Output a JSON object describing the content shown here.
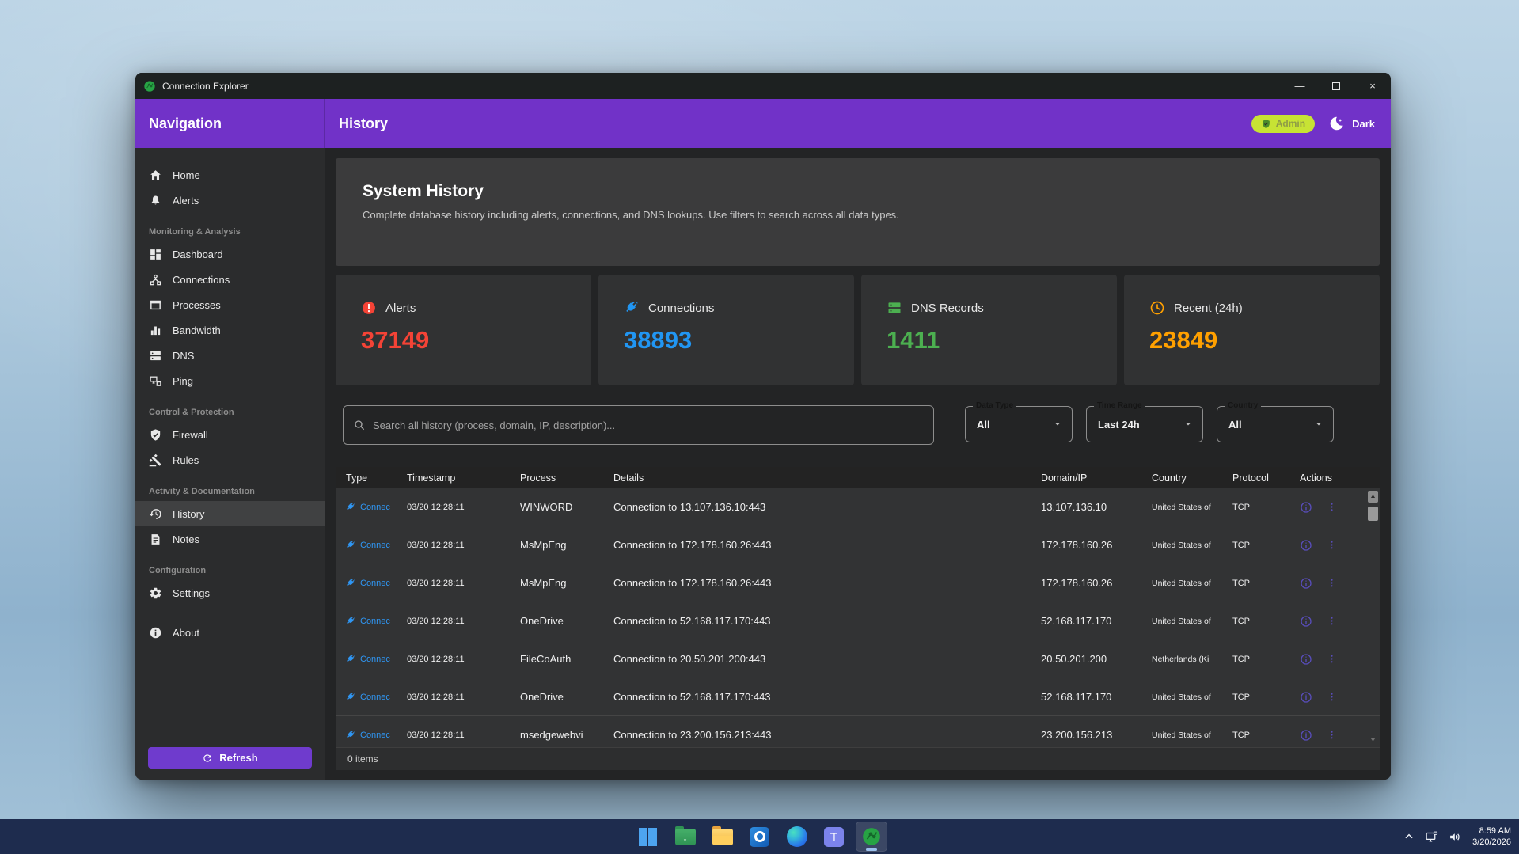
{
  "window": {
    "titlebar": {
      "title": "Connection Explorer"
    },
    "header": {
      "nav_title": "Navigation",
      "page_title": "History",
      "admin_badge": "Admin",
      "theme_label": "Dark"
    },
    "sidebar": {
      "items": [
        {
          "label": "Home"
        },
        {
          "label": "Alerts"
        },
        {
          "section": "Monitoring & Analysis"
        },
        {
          "label": "Dashboard"
        },
        {
          "label": "Connections"
        },
        {
          "label": "Processes"
        },
        {
          "label": "Bandwidth"
        },
        {
          "label": "DNS"
        },
        {
          "label": "Ping"
        },
        {
          "section": "Control & Protection"
        },
        {
          "label": "Firewall"
        },
        {
          "label": "Rules"
        },
        {
          "section": "Activity & Documentation"
        },
        {
          "label": "History"
        },
        {
          "label": "Notes"
        },
        {
          "section": "Configuration"
        },
        {
          "label": "Settings"
        },
        {
          "label": "About"
        }
      ],
      "refresh_label": "Refresh"
    },
    "main": {
      "hero": {
        "title": "System History",
        "subtitle": "Complete database history including alerts, connections, and DNS lookups. Use filters to search across all data types."
      },
      "stats": [
        {
          "label": "Alerts",
          "value": "37149",
          "color": "#f44336"
        },
        {
          "label": "Connections",
          "value": "38893",
          "color": "#2196f3"
        },
        {
          "label": "DNS Records",
          "value": "1411",
          "color": "#4caf50"
        },
        {
          "label": "Recent (24h)",
          "value": "23849",
          "color": "#ffa000"
        }
      ],
      "filters": {
        "search_placeholder": "Search all history (process, domain, IP, description)...",
        "dropdowns": [
          {
            "label": "Data Type",
            "value": "All"
          },
          {
            "label": "Time Range",
            "value": "Last 24h"
          },
          {
            "label": "Country",
            "value": "All"
          }
        ]
      },
      "table": {
        "columns": [
          "Type",
          "Timestamp",
          "Process",
          "Details",
          "Domain/IP",
          "Country",
          "Protocol",
          "Actions"
        ],
        "rows": [
          {
            "type": "Connec",
            "timestamp": "03/20 12:28:11",
            "process": "WINWORD",
            "details": "Connection to 13.107.136.10:443",
            "domain_ip": "13.107.136.10",
            "country": "United States of",
            "protocol": "TCP"
          },
          {
            "type": "Connec",
            "timestamp": "03/20 12:28:11",
            "process": "MsMpEng",
            "details": "Connection to 172.178.160.26:443",
            "domain_ip": "172.178.160.26",
            "country": "United States of",
            "protocol": "TCP"
          },
          {
            "type": "Connec",
            "timestamp": "03/20 12:28:11",
            "process": "MsMpEng",
            "details": "Connection to 172.178.160.26:443",
            "domain_ip": "172.178.160.26",
            "country": "United States of",
            "protocol": "TCP"
          },
          {
            "type": "Connec",
            "timestamp": "03/20 12:28:11",
            "process": "OneDrive",
            "details": "Connection to 52.168.117.170:443",
            "domain_ip": "52.168.117.170",
            "country": "United States of",
            "protocol": "TCP"
          },
          {
            "type": "Connec",
            "timestamp": "03/20 12:28:11",
            "process": "FileCoAuth",
            "details": "Connection to 20.50.201.200:443",
            "domain_ip": "20.50.201.200",
            "country": "Netherlands (Ki",
            "protocol": "TCP"
          },
          {
            "type": "Connec",
            "timestamp": "03/20 12:28:11",
            "process": "OneDrive",
            "details": "Connection to 52.168.117.170:443",
            "domain_ip": "52.168.117.170",
            "country": "United States of",
            "protocol": "TCP"
          },
          {
            "type": "Connec",
            "timestamp": "03/20 12:28:11",
            "process": "msedgewebvi",
            "details": "Connection to 23.200.156.213:443",
            "domain_ip": "23.200.156.213",
            "country": "United States of",
            "protocol": "TCP"
          }
        ]
      },
      "status": "0 items"
    }
  },
  "taskbar": {
    "tray": {
      "time": "8:59 AM",
      "date": "3/20/2026"
    }
  }
}
